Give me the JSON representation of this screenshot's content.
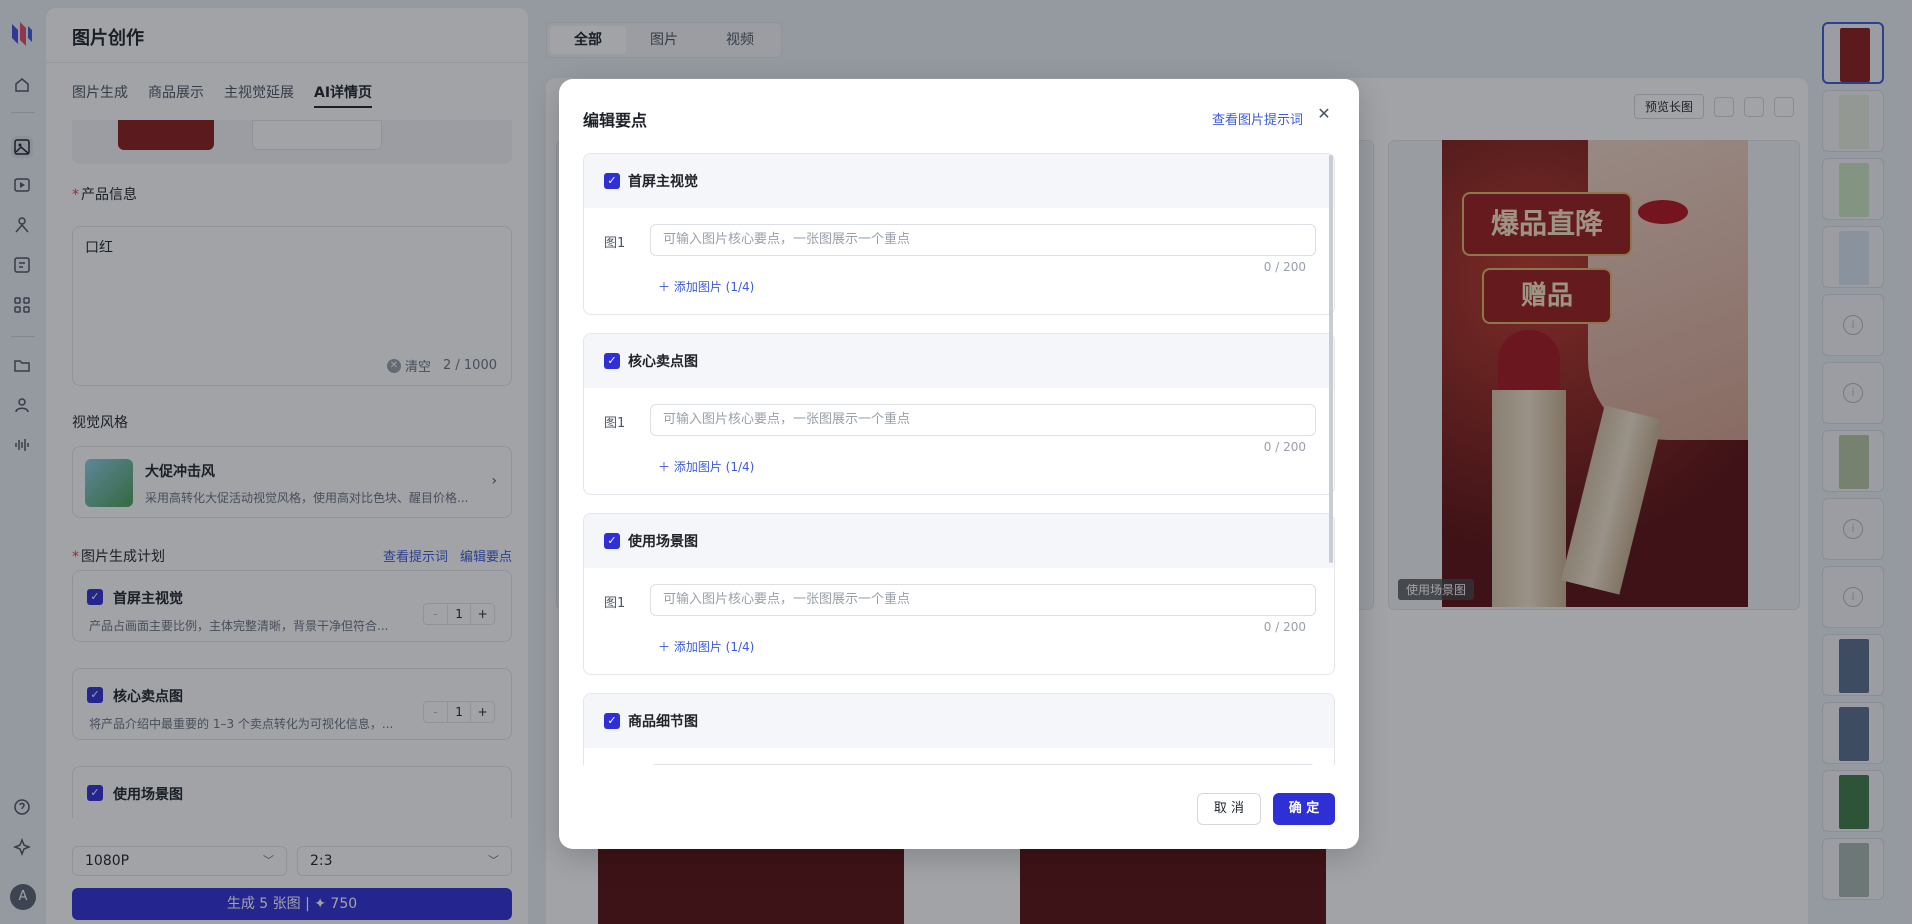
{
  "app": {
    "panel_title": "图片创作",
    "tabs": [
      "图片生成",
      "商品展示",
      "主视觉延展",
      "AI详情页"
    ],
    "active_tab": "AI详情页"
  },
  "product": {
    "label": "产品信息",
    "value": "口红",
    "clear_label": "清空",
    "count": "2 / 1000"
  },
  "style": {
    "label": "视觉风格",
    "name": "大促冲击风",
    "desc": "采用高转化大促活动视觉风格，使用高对比色块、醒目价格..."
  },
  "plan": {
    "label": "图片生成计划",
    "view_prompt": "查看提示词",
    "edit_points": "编辑要点",
    "items": [
      {
        "title": "首屏主视觉",
        "desc": "产品占画面主要比例，主体完整清晰，背景干净但符合...",
        "qty": "1"
      },
      {
        "title": "核心卖点图",
        "desc": "将产品介绍中最重要的 1–3 个卖点转化为可视化信息，...",
        "qty": "1"
      },
      {
        "title": "使用场景图",
        "desc": "",
        "qty": "1"
      }
    ],
    "stepper_minus": "-",
    "stepper_plus": "+"
  },
  "settings": {
    "resolution": "1080P",
    "ratio": "2:3"
  },
  "generate": {
    "label": "生成 5 张图 | ✦ 750"
  },
  "filter": {
    "segments": [
      "全部",
      "图片",
      "视频"
    ],
    "active": "全部"
  },
  "toolbar": {
    "preview_long": "预览长图"
  },
  "poster": {
    "badge1": "爆品直降",
    "badge2": "赠品",
    "tag": "使用场景图"
  },
  "modal": {
    "title": "编辑要点",
    "view_prompt_link": "查看图片提示词",
    "placeholder": "可输入图片核心要点，一张图展示一个重点",
    "row_label": "图1",
    "count": "0 / 200",
    "add_image": "添加图片 (1/4)",
    "sections": [
      {
        "title": "首屏主视觉"
      },
      {
        "title": "核心卖点图"
      },
      {
        "title": "使用场景图"
      },
      {
        "title": "商品细节图"
      }
    ],
    "cancel": "取 消",
    "confirm": "确 定"
  },
  "colors": {
    "accent": "#2f2fd6",
    "link": "#3b5bdb",
    "poster_red": "#9b1b1b"
  },
  "user": {
    "avatar_letter": "A"
  }
}
